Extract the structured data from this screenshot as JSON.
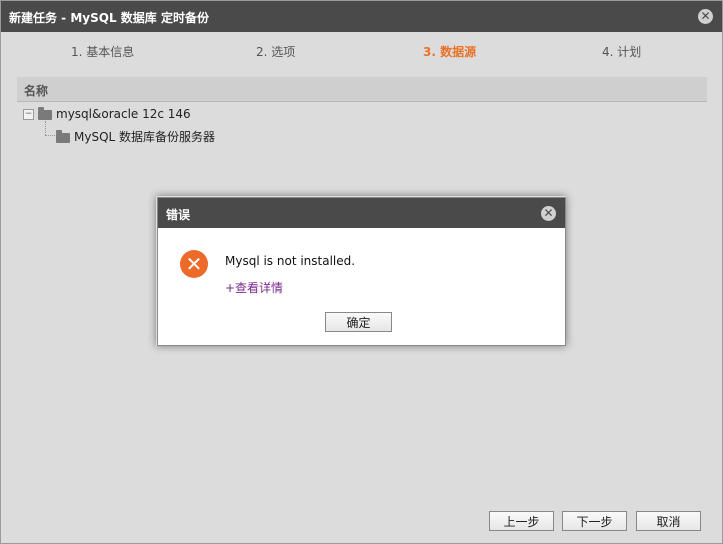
{
  "window": {
    "title": "新建任务 - MySQL 数据库 定时备份",
    "close_glyph": "✕"
  },
  "steps": [
    {
      "label": "1. 基本信息",
      "active": false
    },
    {
      "label": "2. 选项",
      "active": false
    },
    {
      "label": "3. 数据源",
      "active": true
    },
    {
      "label": "4. 计划",
      "active": false
    }
  ],
  "tree": {
    "header": "名称",
    "root": {
      "label": "mysql&oracle 12c 146",
      "expander": "−"
    },
    "child": {
      "label": "MySQL 数据库备份服务器"
    }
  },
  "dialog": {
    "title": "错误",
    "close_glyph": "✕",
    "icon_glyph": "✕",
    "message": "Mysql is not installed.",
    "details_link": "+查看详情",
    "ok_label": "确定"
  },
  "footer": {
    "prev_label": "上一步",
    "next_label": "下一步",
    "cancel_label": "取消"
  },
  "colors": {
    "titlebar": "#4a4a4a",
    "active_step": "#e8742a",
    "error_icon": "#ee6a2b",
    "link": "#7a2a8a"
  }
}
